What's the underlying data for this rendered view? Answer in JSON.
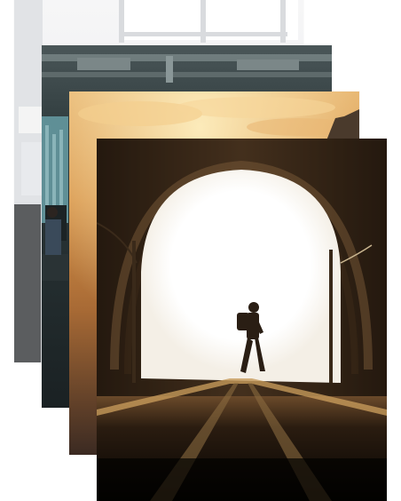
{
  "photos": [
    {
      "subject": "office-window",
      "palette": [
        "#f3f4f5",
        "#dfe2e5",
        "#c9ccd0"
      ]
    },
    {
      "subject": "office-interior",
      "palette": [
        "#3d4a4d",
        "#6e7f80",
        "#1f2a2c"
      ]
    },
    {
      "subject": "sunset-sky",
      "palette": [
        "#f6c87a",
        "#d99a4b",
        "#5b4230"
      ]
    },
    {
      "subject": "tunnel-hiker",
      "palette": [
        "#000000",
        "#ffffff",
        "#6b4a2a"
      ]
    }
  ]
}
